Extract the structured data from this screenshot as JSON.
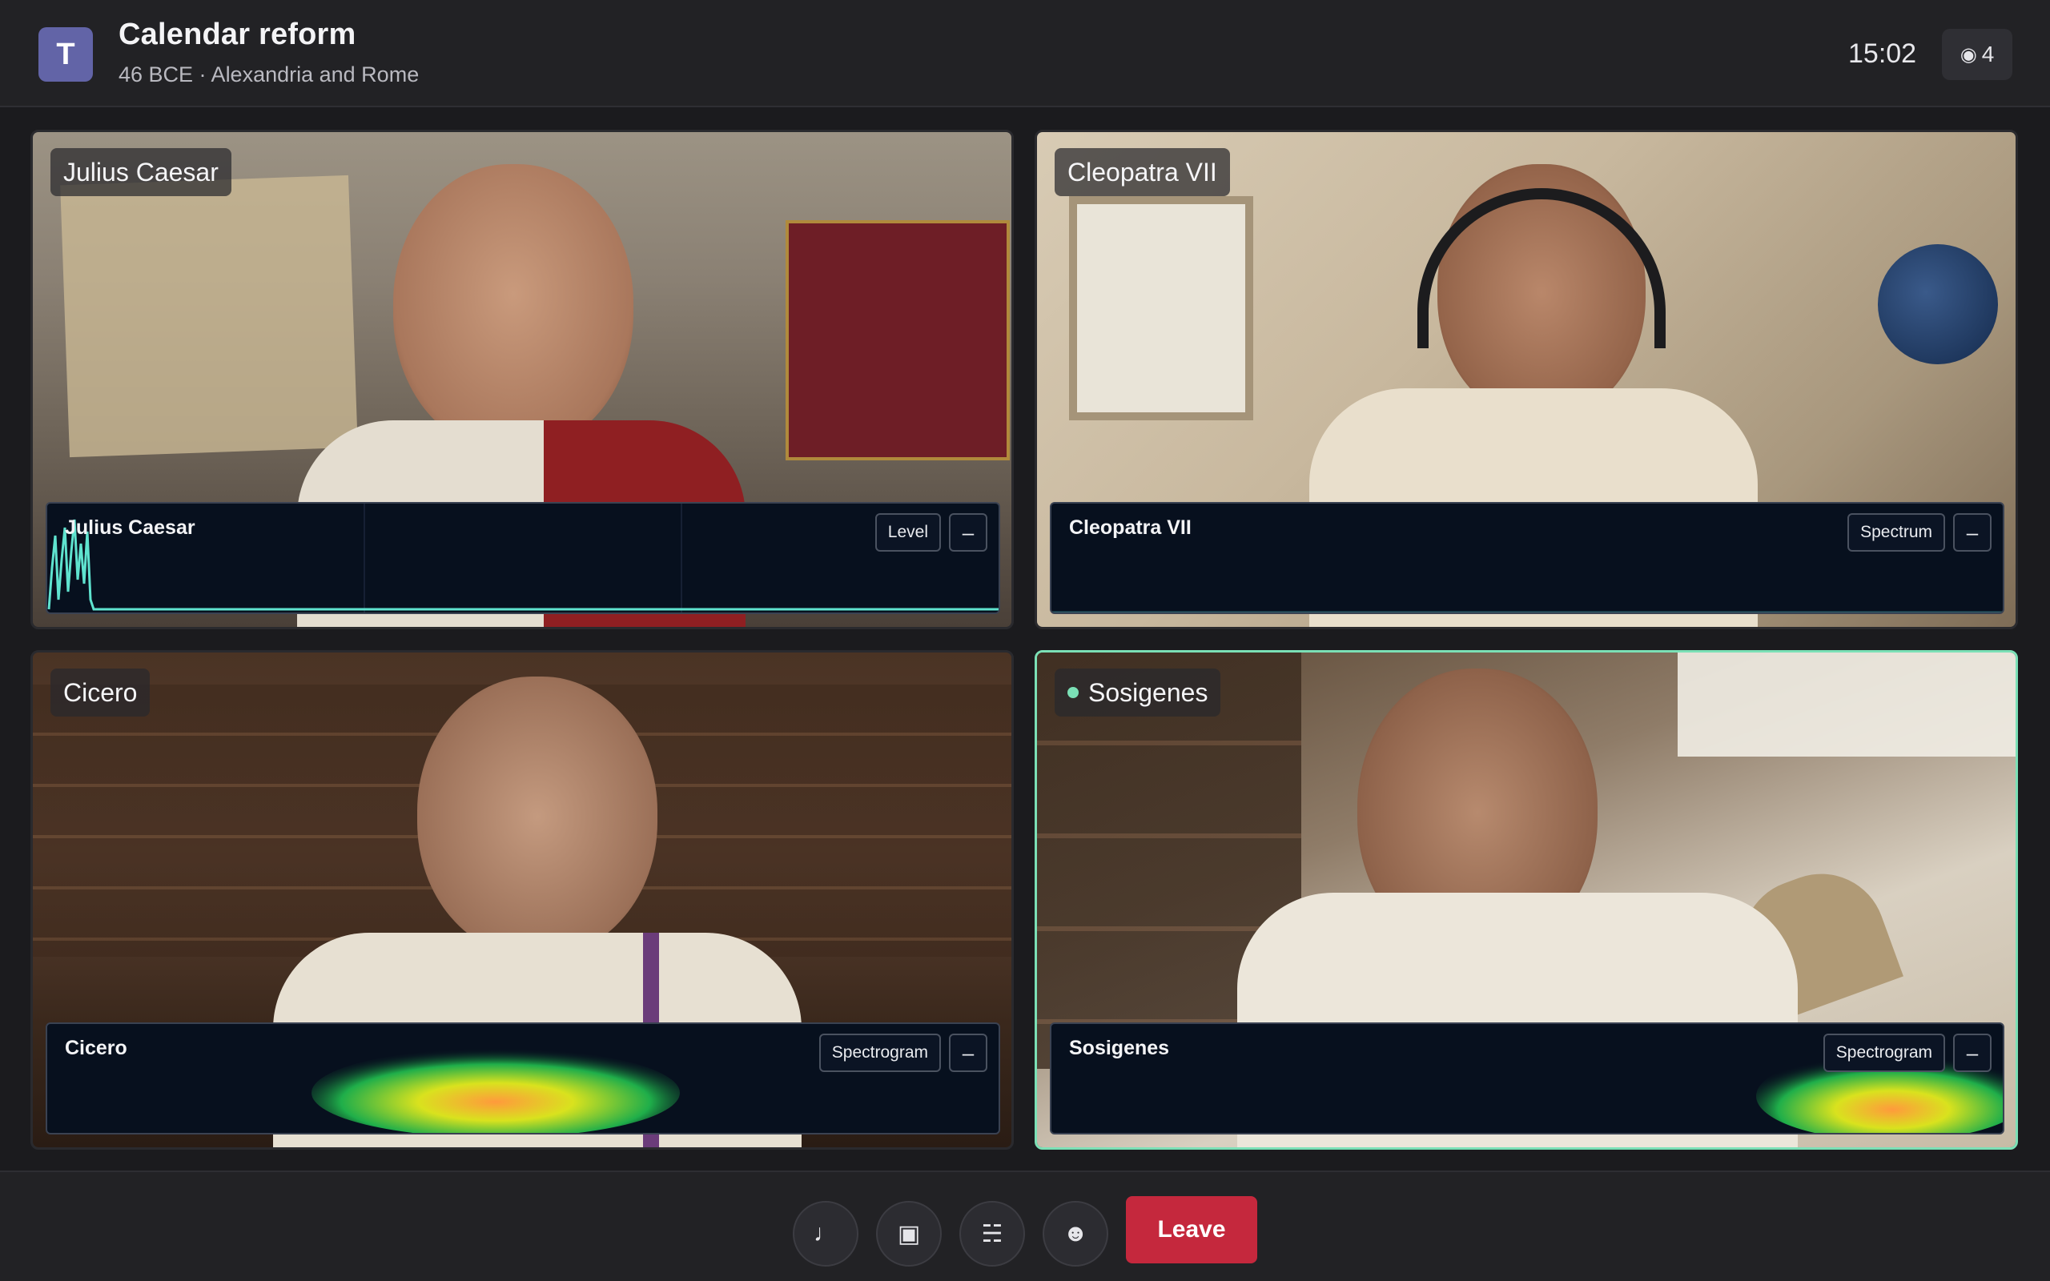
{
  "app": {
    "logo_letter": "T"
  },
  "meeting": {
    "title": "Calendar reform",
    "subtitle": "46 BCE · Alexandria and Rome",
    "clock": "15:02",
    "participants_icon": "◉",
    "participants_count": "4"
  },
  "tiles": [
    {
      "name": "Julius Caesar",
      "viz_label": "Julius Caesar",
      "viz_mode": "Level",
      "min_icon": "–",
      "speaking": false,
      "viz_color": "#5fe3cf"
    },
    {
      "name": "Cleopatra VII",
      "viz_label": "Cleopatra VII",
      "viz_mode": "Spectrum",
      "min_icon": "–",
      "speaking": false,
      "viz_color": "#5fe3cf"
    },
    {
      "name": "Cicero",
      "viz_label": "Cicero",
      "viz_mode": "Spectrogram",
      "min_icon": "–",
      "speaking": false
    },
    {
      "name": "Sosigenes",
      "viz_label": "Sosigenes",
      "viz_mode": "Spectrogram",
      "min_icon": "–",
      "speaking": true
    }
  ],
  "controls": {
    "mic_icon": "♩",
    "camera_icon": "▣",
    "share_icon": "☵",
    "react_icon": "☻",
    "leave_label": "Leave"
  },
  "colors": {
    "accent": "#7be0b6",
    "leave": "#c5283d",
    "brand": "#6264a7"
  }
}
